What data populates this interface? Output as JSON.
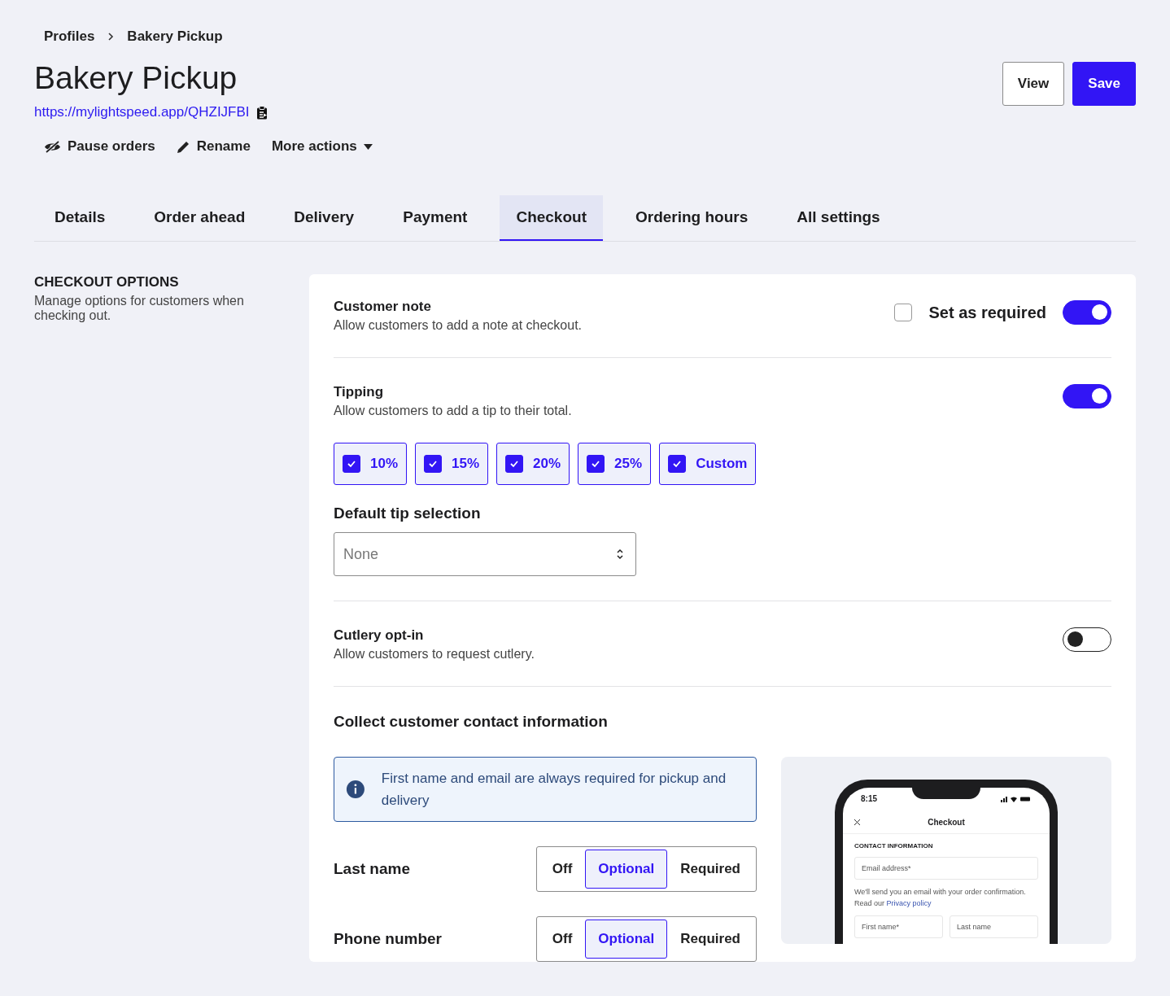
{
  "breadcrumb": [
    {
      "label": "Profiles"
    },
    {
      "label": "Bakery Pickup"
    }
  ],
  "title": "Bakery Pickup",
  "url": "https://mylightspeed.app/QHZIJFBI",
  "header_buttons": [
    {
      "label": "View",
      "kind": "secondary"
    },
    {
      "label": "Save",
      "kind": "primary"
    }
  ],
  "actions": [
    {
      "label": "Pause orders",
      "kind": "pause"
    },
    {
      "label": "Rename",
      "kind": "rename"
    },
    {
      "label": "More actions",
      "kind": "menu"
    }
  ],
  "tabs": [
    {
      "label": "Details",
      "selected": false
    },
    {
      "label": "Order ahead",
      "selected": false
    },
    {
      "label": "Delivery",
      "selected": false
    },
    {
      "label": "Payment",
      "selected": false
    },
    {
      "label": "Checkout",
      "selected": true
    },
    {
      "label": "Ordering hours",
      "selected": false
    },
    {
      "label": "All settings",
      "selected": false
    }
  ],
  "section": {
    "heading": "CHECKOUT OPTIONS",
    "description": "Manage options for customers when checking out."
  },
  "customer_note": {
    "title": "Customer note",
    "description": "Allow customers to add a note at checkout.",
    "required_label": "Set as required",
    "required_checked": false,
    "on": true
  },
  "tipping": {
    "title": "Tipping",
    "description": "Allow customers to add a tip to their total.",
    "on": true,
    "options": [
      {
        "label": "10%",
        "checked": true
      },
      {
        "label": "15%",
        "checked": true
      },
      {
        "label": "20%",
        "checked": true
      },
      {
        "label": "25%",
        "checked": true
      },
      {
        "label": "Custom",
        "checked": true
      }
    ],
    "default_label": "Default tip selection",
    "default_value": "None"
  },
  "cutlery": {
    "title": "Cutlery opt-in",
    "description": "Allow customers to request cutlery.",
    "on": false
  },
  "contact": {
    "title": "Collect customer contact information",
    "info": "First name and email are always required for pickup and delivery",
    "fields": [
      {
        "label": "Last name",
        "options": [
          {
            "label": "Off",
            "selected": false
          },
          {
            "label": "Optional",
            "selected": true
          },
          {
            "label": "Required",
            "selected": false
          }
        ]
      },
      {
        "label": "Phone number",
        "options": [
          {
            "label": "Off",
            "selected": false
          },
          {
            "label": "Optional",
            "selected": true
          },
          {
            "label": "Required",
            "selected": false
          }
        ]
      }
    ],
    "preview": {
      "time": "8:15",
      "title": "Checkout",
      "section": "CONTACT INFORMATION",
      "email": "Email address*",
      "note": "We'll send you an email with your order confirmation. Read our",
      "link": "Privacy policy",
      "first_name": "First name*",
      "last_name": "Last name"
    }
  }
}
